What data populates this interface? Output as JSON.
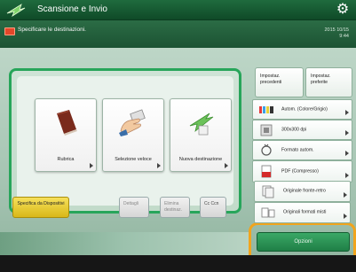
{
  "header": {
    "title": "Scansione e Invio",
    "app_icon": "scan-send-icon",
    "settings_icon": "gear-icon"
  },
  "instruction": {
    "icon": "destination-card-icon",
    "text": "Specificare le destinazioni.",
    "date": "2015 10/15",
    "time": "9:44"
  },
  "destination_buttons": [
    {
      "label": "Rubrica",
      "icon": "address-book-icon"
    },
    {
      "label": "Selezione veloce",
      "icon": "one-touch-hand-icon"
    },
    {
      "label": "Nuova destinazione",
      "icon": "new-destination-icon"
    }
  ],
  "bottom_buttons": {
    "specify": "Specifica da Dispositivi",
    "details": "Dettagli",
    "delete": "Elimina destinaz.",
    "cc_bcc": "Cc Ccn"
  },
  "right_panel": {
    "recall_label": "Impostaz. precedenti",
    "favorites_label": "Impostaz. preferite",
    "rows": [
      {
        "label": "Autom. (Colore/Grigio)",
        "icon": "color-mode-icon"
      },
      {
        "label": "300x300 dpi",
        "icon": "resolution-icon"
      },
      {
        "label": "Formato autom.",
        "icon": "scan-size-icon"
      },
      {
        "label": "PDF (Compresso)",
        "icon": "file-format-icon"
      },
      {
        "label": "Originale fronte-retro",
        "icon": "two-sided-original-icon"
      },
      {
        "label": "Originali formati misti",
        "icon": "mixed-size-originals-icon"
      }
    ],
    "options_label": "Opzioni"
  },
  "colors": {
    "accent_green": "#27a55a",
    "header_green": "#1f6b3e",
    "highlight_orange": "#f1a41d",
    "button_yellow": "#e8c92b"
  }
}
